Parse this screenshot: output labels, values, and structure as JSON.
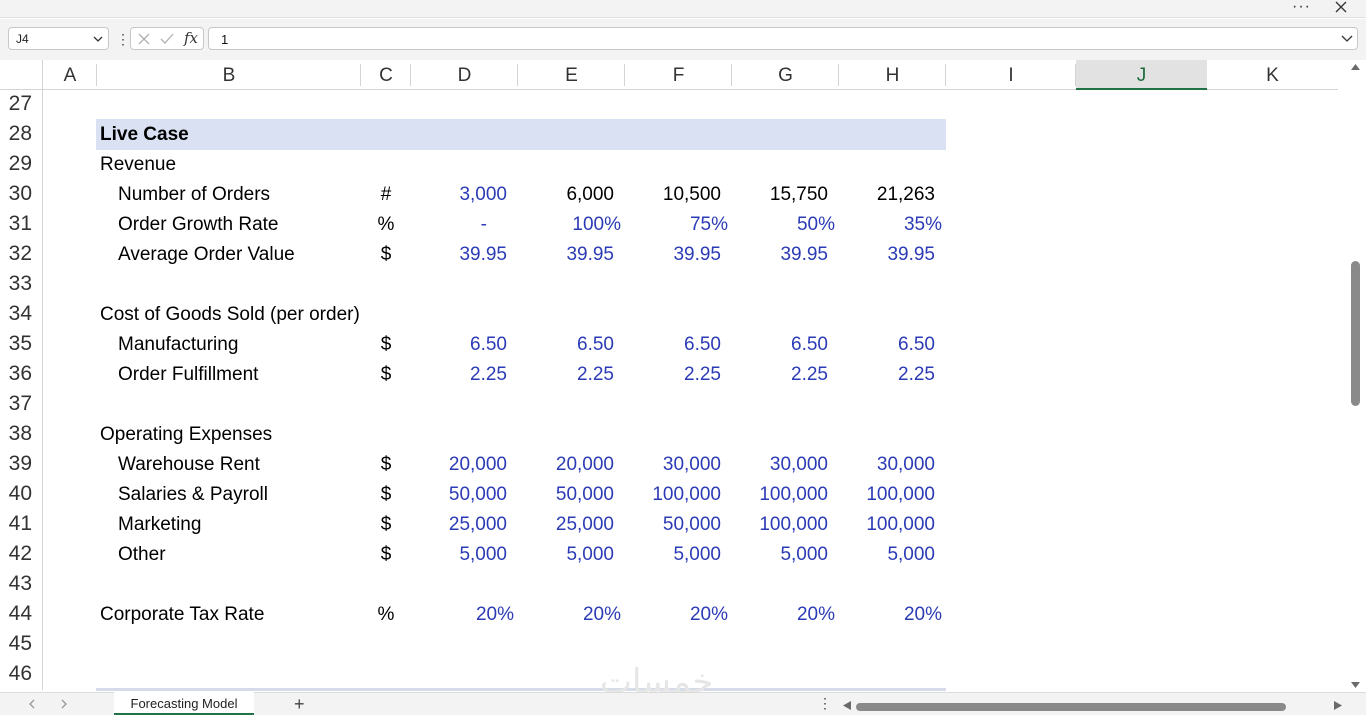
{
  "window": {
    "more_label": "···"
  },
  "formula_bar": {
    "name_box": "J4",
    "fx_label": "fx",
    "value": "1"
  },
  "columns": [
    "A",
    "B",
    "C",
    "D",
    "E",
    "F",
    "G",
    "H",
    "I",
    "J",
    "K"
  ],
  "selected_column": "J",
  "rows": [
    "27",
    "28",
    "29",
    "30",
    "31",
    "32",
    "33",
    "34",
    "35",
    "36",
    "37",
    "38",
    "39",
    "40",
    "41",
    "42",
    "43",
    "44",
    "45",
    "46"
  ],
  "sheet": {
    "section_title": "Live Case",
    "revenue_label": "Revenue",
    "number_of_orders": {
      "label": "Number of Orders",
      "unit": "#",
      "values": [
        "3,000",
        "6,000",
        "10,500",
        "15,750",
        "21,263"
      ]
    },
    "order_growth_rate": {
      "label": "Order Growth Rate",
      "unit": "%",
      "values": [
        "-",
        "100%",
        "75%",
        "50%",
        "35%"
      ]
    },
    "average_order_value": {
      "label": "Average Order Value",
      "unit": "$",
      "values": [
        "39.95",
        "39.95",
        "39.95",
        "39.95",
        "39.95"
      ]
    },
    "cogs_label": "Cost of Goods Sold (per order)",
    "manufacturing": {
      "label": "Manufacturing",
      "unit": "$",
      "values": [
        "6.50",
        "6.50",
        "6.50",
        "6.50",
        "6.50"
      ]
    },
    "order_fulfillment": {
      "label": "Order Fulfillment",
      "unit": "$",
      "values": [
        "2.25",
        "2.25",
        "2.25",
        "2.25",
        "2.25"
      ]
    },
    "opex_label": "Operating Expenses",
    "warehouse_rent": {
      "label": "Warehouse Rent",
      "unit": "$",
      "values": [
        "20,000",
        "20,000",
        "30,000",
        "30,000",
        "30,000"
      ]
    },
    "salaries_payroll": {
      "label": "Salaries & Payroll",
      "unit": "$",
      "values": [
        "50,000",
        "50,000",
        "100,000",
        "100,000",
        "100,000"
      ]
    },
    "marketing": {
      "label": "Marketing",
      "unit": "$",
      "values": [
        "25,000",
        "25,000",
        "50,000",
        "100,000",
        "100,000"
      ]
    },
    "other": {
      "label": "Other",
      "unit": "$",
      "values": [
        "5,000",
        "5,000",
        "5,000",
        "5,000",
        "5,000"
      ]
    },
    "corporate_tax_rate": {
      "label": "Corporate Tax Rate",
      "unit": "%",
      "values": [
        "20%",
        "20%",
        "20%",
        "20%",
        "20%"
      ]
    }
  },
  "tabs": {
    "active": "Forecasting Model",
    "add_label": "+"
  },
  "watermark": "خمسات",
  "colors": {
    "input_blue": "#2b3bb5",
    "header_band": "#d9e1f2",
    "excel_green": "#217346"
  }
}
